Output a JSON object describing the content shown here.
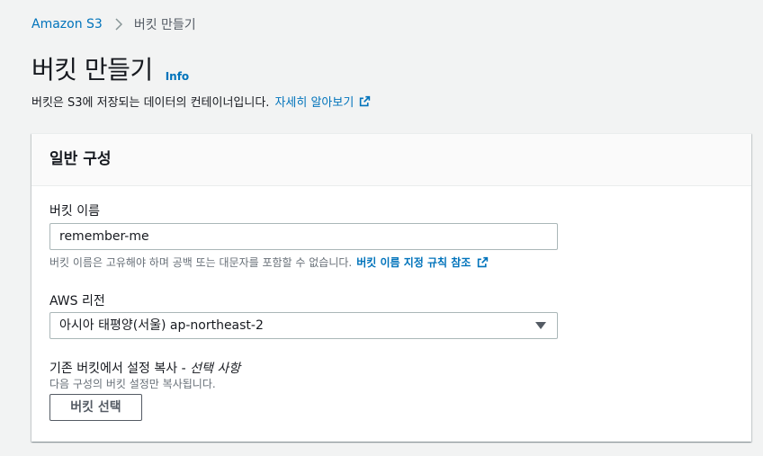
{
  "breadcrumb": {
    "root": "Amazon S3",
    "current": "버킷 만들기"
  },
  "header": {
    "title": "버킷 만들기",
    "info": "Info",
    "description": "버킷은 S3에 저장되는 데이터의 컨테이너입니다.",
    "learn_more": "자세히 알아보기"
  },
  "general": {
    "title": "일반 구성",
    "bucket_name_label": "버킷 이름",
    "bucket_name_value": "remember-me",
    "bucket_name_hint": "버킷 이름은 고유해야 하며 공백 또는 대문자를 포함할 수 없습니다.",
    "naming_rules_link": "버킷 이름 지정 규칙 참조",
    "region_label": "AWS 리전",
    "region_value": "아시아 태평양(서울) ap-northeast-2",
    "copy_label": "기존 버킷에서 설정 복사 -",
    "copy_optional": "선택 사항",
    "copy_desc": "다음 구성의 버킷 설정만 복사됩니다.",
    "choose_bucket_button": "버킷 선택"
  },
  "colors": {
    "link": "#0073bb",
    "background": "#f2f3f3",
    "text": "#16191f"
  },
  "icons": {
    "breadcrumb_separator": "chevron-right-icon",
    "external_link": "external-link-icon",
    "select_caret": "caret-down-icon"
  }
}
